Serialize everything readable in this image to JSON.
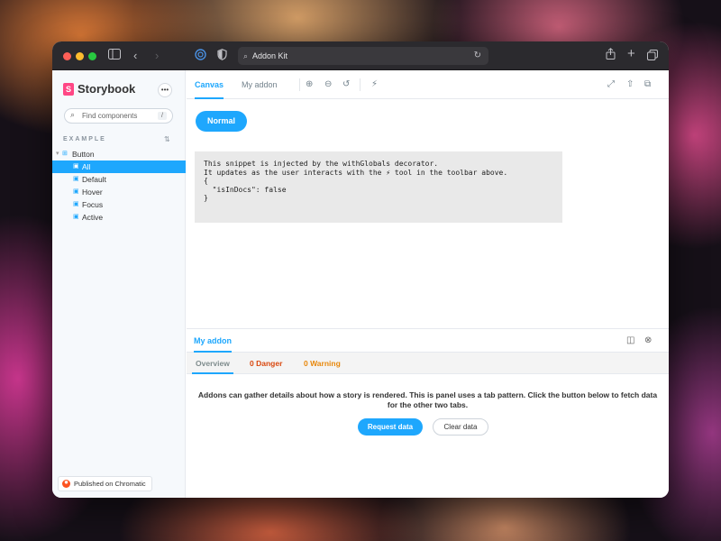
{
  "browser": {
    "url_text": "Addon Kit",
    "traffic_lights": [
      "#ff5f57",
      "#febc2e",
      "#28c840"
    ]
  },
  "sidebar": {
    "brand": "Storybook",
    "search_placeholder": "Find components",
    "search_shortcut": "/",
    "section_title": "EXAMPLE",
    "component": "Button",
    "stories": [
      {
        "label": "All",
        "selected": true
      },
      {
        "label": "Default",
        "selected": false
      },
      {
        "label": "Hover",
        "selected": false
      },
      {
        "label": "Focus",
        "selected": false
      },
      {
        "label": "Active",
        "selected": false
      }
    ],
    "chromatic_badge": "Published on Chromatic"
  },
  "toolbar": {
    "tabs": [
      {
        "label": "Canvas",
        "active": true
      },
      {
        "label": "My addon",
        "active": false
      }
    ]
  },
  "canvas": {
    "button_label": "Normal",
    "snippet_lines": [
      "This snippet is injected by the withGlobals decorator.",
      "It updates as the user interacts with the ⚡ tool in the toolbar above.",
      "",
      "{",
      "  \"isInDocs\": false",
      "}"
    ]
  },
  "panel": {
    "tab_label": "My addon",
    "subtabs": [
      {
        "label": "Overview",
        "color": "#7f8c8d",
        "active": true
      },
      {
        "label": "0 Danger",
        "color": "#d9480f",
        "active": false
      },
      {
        "label": "0 Warning",
        "color": "#e8880c",
        "active": false
      }
    ],
    "message": "Addons can gather details about how a story is rendered. This is panel uses a tab pattern. Click the button below to fetch data for the other two tabs.",
    "primary_button": "Request data",
    "secondary_button": "Clear data"
  },
  "colors": {
    "accent": "#1ea7fd",
    "storybook_pink": "#ff4785"
  }
}
